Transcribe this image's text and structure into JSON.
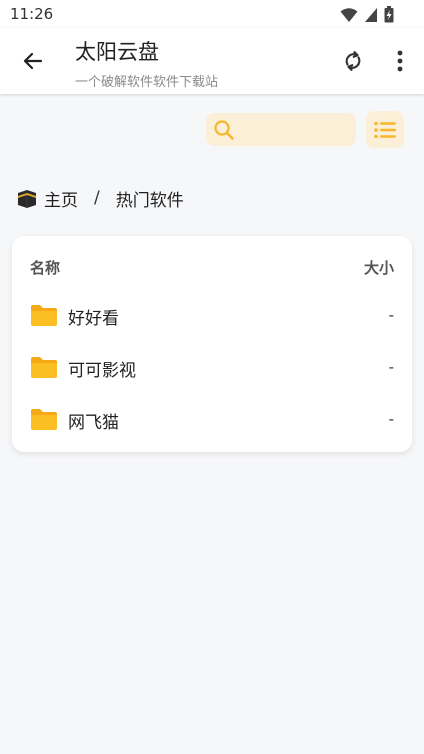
{
  "status_bar": {
    "time": "11:26"
  },
  "app_bar": {
    "title": "太阳云盘",
    "subtitle": "一个破解软件软件下载站"
  },
  "search": {
    "placeholder": "",
    "value": ""
  },
  "breadcrumb": {
    "home": "主页",
    "separator": "/",
    "current": "热门软件"
  },
  "table": {
    "headers": {
      "name": "名称",
      "size": "大小"
    },
    "rows": [
      {
        "name": "好好看",
        "size": "-"
      },
      {
        "name": "可可影视",
        "size": "-"
      },
      {
        "name": "网飞猫",
        "size": "-"
      }
    ]
  },
  "colors": {
    "accent": "#f7b62b",
    "accent_light": "#fbefd7",
    "background": "#f6f7f9",
    "folder": "#fbbf24"
  },
  "icons": {
    "back": "arrow-left-icon",
    "refresh": "refresh-icon",
    "more": "more-vertical-icon",
    "search": "search-icon",
    "list": "list-icon",
    "home": "kaaba-icon",
    "folder": "folder-icon"
  }
}
